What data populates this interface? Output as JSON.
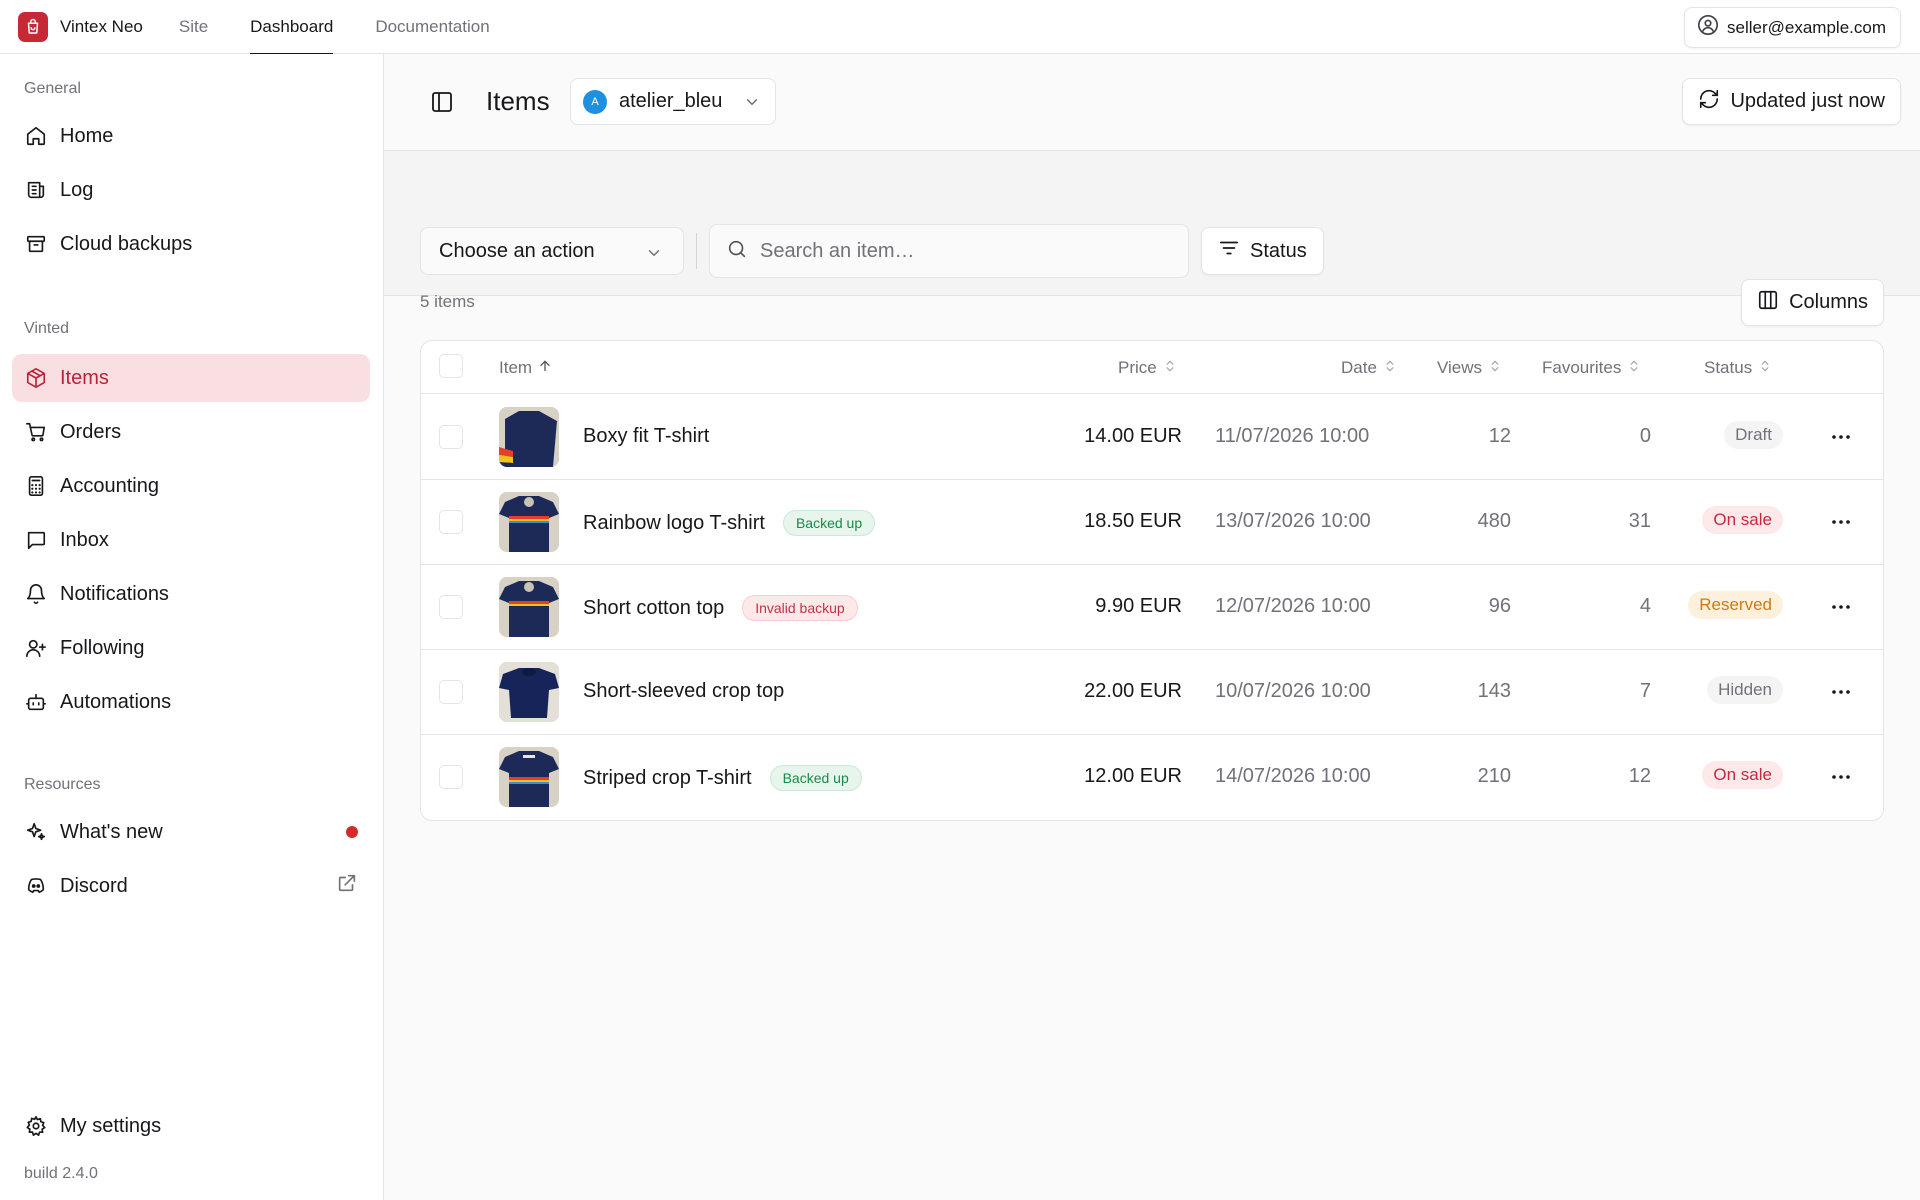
{
  "topbar": {
    "brand": "Vintex Neo",
    "nav": [
      {
        "label": "Site",
        "active": false
      },
      {
        "label": "Dashboard",
        "active": true
      },
      {
        "label": "Documentation",
        "active": false
      }
    ],
    "account": "seller@example.com"
  },
  "sidebar": {
    "sections": {
      "general": "General",
      "vinted": "Vinted",
      "resources": "Resources"
    },
    "general_items": [
      {
        "label": "Home",
        "icon": "home-icon"
      },
      {
        "label": "Log",
        "icon": "log-icon"
      },
      {
        "label": "Cloud backups",
        "icon": "archive-icon"
      }
    ],
    "vinted_items": [
      {
        "label": "Items",
        "icon": "package-icon",
        "active": true
      },
      {
        "label": "Orders",
        "icon": "cart-icon"
      },
      {
        "label": "Accounting",
        "icon": "calculator-icon"
      },
      {
        "label": "Inbox",
        "icon": "message-icon"
      },
      {
        "label": "Notifications",
        "icon": "bell-icon"
      },
      {
        "label": "Following",
        "icon": "user-plus-icon"
      },
      {
        "label": "Automations",
        "icon": "bot-icon"
      }
    ],
    "resource_items": [
      {
        "label": "What's new",
        "icon": "sparkles-icon"
      },
      {
        "label": "Discord",
        "icon": "discord-icon"
      }
    ],
    "settings": "My settings",
    "build": "build 2.4.0"
  },
  "header": {
    "title": "Items",
    "account_initial": "A",
    "account_name": "atelier_bleu",
    "updated": "Updated just now"
  },
  "toolbar": {
    "action_placeholder": "Choose an action",
    "search_placeholder": "Search an item…",
    "status_filter": "Status"
  },
  "list": {
    "count": "5 items",
    "columns_button": "Columns",
    "headers": {
      "item": "Item",
      "price": "Price",
      "date": "Date",
      "views": "Views",
      "favourites": "Favourites",
      "status": "Status"
    },
    "rows": [
      {
        "name": "Boxy fit T-shirt",
        "tag": "",
        "tag_type": "",
        "price": "14.00 EUR",
        "date": "11/07/2026 10:00",
        "views": "12",
        "favourites": "0",
        "status": "Draft",
        "status_type": "draft"
      },
      {
        "name": "Rainbow logo T-shirt",
        "tag": "Backed up",
        "tag_type": "backed",
        "price": "18.50 EUR",
        "date": "13/07/2026 10:00",
        "views": "480",
        "favourites": "31",
        "status": "On sale",
        "status_type": "sale"
      },
      {
        "name": "Short cotton top",
        "tag": "Invalid backup",
        "tag_type": "invalid",
        "price": "9.90 EUR",
        "date": "12/07/2026 10:00",
        "views": "96",
        "favourites": "4",
        "status": "Reserved",
        "status_type": "reserved"
      },
      {
        "name": "Short-sleeved crop top",
        "tag": "",
        "tag_type": "",
        "price": "22.00 EUR",
        "date": "10/07/2026 10:00",
        "views": "143",
        "favourites": "7",
        "status": "Hidden",
        "status_type": "hidden"
      },
      {
        "name": "Striped crop T-shirt",
        "tag": "Backed up",
        "tag_type": "backed",
        "price": "12.00 EUR",
        "date": "14/07/2026 10:00",
        "views": "210",
        "favourites": "12",
        "status": "On sale",
        "status_type": "sale"
      }
    ]
  },
  "colors": {
    "brand": "#c62835",
    "active_bg": "#f9dfe2",
    "active_text": "#b8233a"
  }
}
